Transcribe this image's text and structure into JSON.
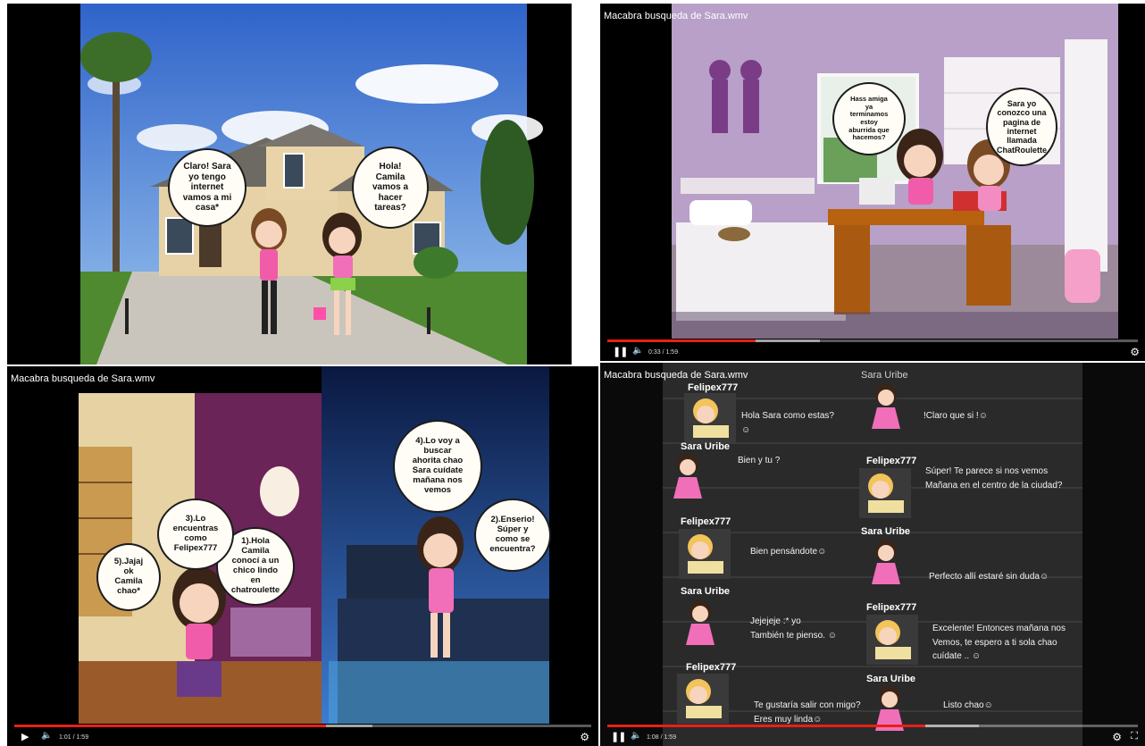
{
  "panel1": {
    "bubbles": {
      "sara": "Claro! Sara\nyo tengo\ninternet\nvamos a mi\ncasa*",
      "camila": "Hola!\nCamila\nvamos a\nhacer\ntareas?"
    }
  },
  "panel2": {
    "title": "Macabra busqueda de Sara.wmv",
    "bubbles": {
      "left": "Hass amiga\nya\nterminamos\nestoy\naburrida que\nhacemos?",
      "right": "Sara yo\nconozco una\npagina de\ninternet\nllamada\nChatRoulette"
    },
    "player": {
      "time": "0:33 / 1:59",
      "progress": 0.28
    }
  },
  "panel3": {
    "title": "Macabra busqueda de Sara.wmv",
    "bubbles": {
      "b1": "1).Hola\nCamila\nconocí a un\nchico lindo\nen\nchatroulette",
      "b2": "2).Enserio!\nSúper y\ncomo se\nencuentra?",
      "b3": "3).Lo\nencuentras\ncomo\nFelipex777",
      "b4": "4).Lo voy a\nbuscar\nahorita chao\nSara cuídate\nmañana nos\nvemos",
      "b5": "5).Jajaj\nok\nCamila\nchao*"
    },
    "player": {
      "time": "1:01 / 1:59",
      "progress": 0.54
    }
  },
  "panel4": {
    "title": "Macabra busqueda de Sara.wmv",
    "names": {
      "sara": "Sara Uribe",
      "felipe": "Felipex777"
    },
    "messages": {
      "m1": "Hola Sara como estas?\n☺",
      "m2": "!Claro que si !☺",
      "m3": "Bien y tu ?",
      "m4": "Súper! Te parece si nos vemos\nMañana en el centro de la ciudad?",
      "m5": "Bien pensándote☺",
      "m6": "Perfecto allí estaré sin duda☺",
      "m7": "Jejejeje :* yo\nTambién te pienso. ☺",
      "m8": "Excelente! Entonces mañana nos\nVemos, te espero a ti sola chao\ncuídate .. ☺",
      "m9": "Te gustaría salir con migo?\nEres muy linda☺",
      "m10": "Listo chao☺"
    },
    "player": {
      "time": "1:08 / 1:59",
      "progress": 0.6
    }
  },
  "colors": {
    "progress_red": "#e62117",
    "bubble_bg": "#fffdf6"
  },
  "icons": [
    "play-icon",
    "pause-icon",
    "volume-icon",
    "settings-gear-icon",
    "fullscreen-icon"
  ]
}
